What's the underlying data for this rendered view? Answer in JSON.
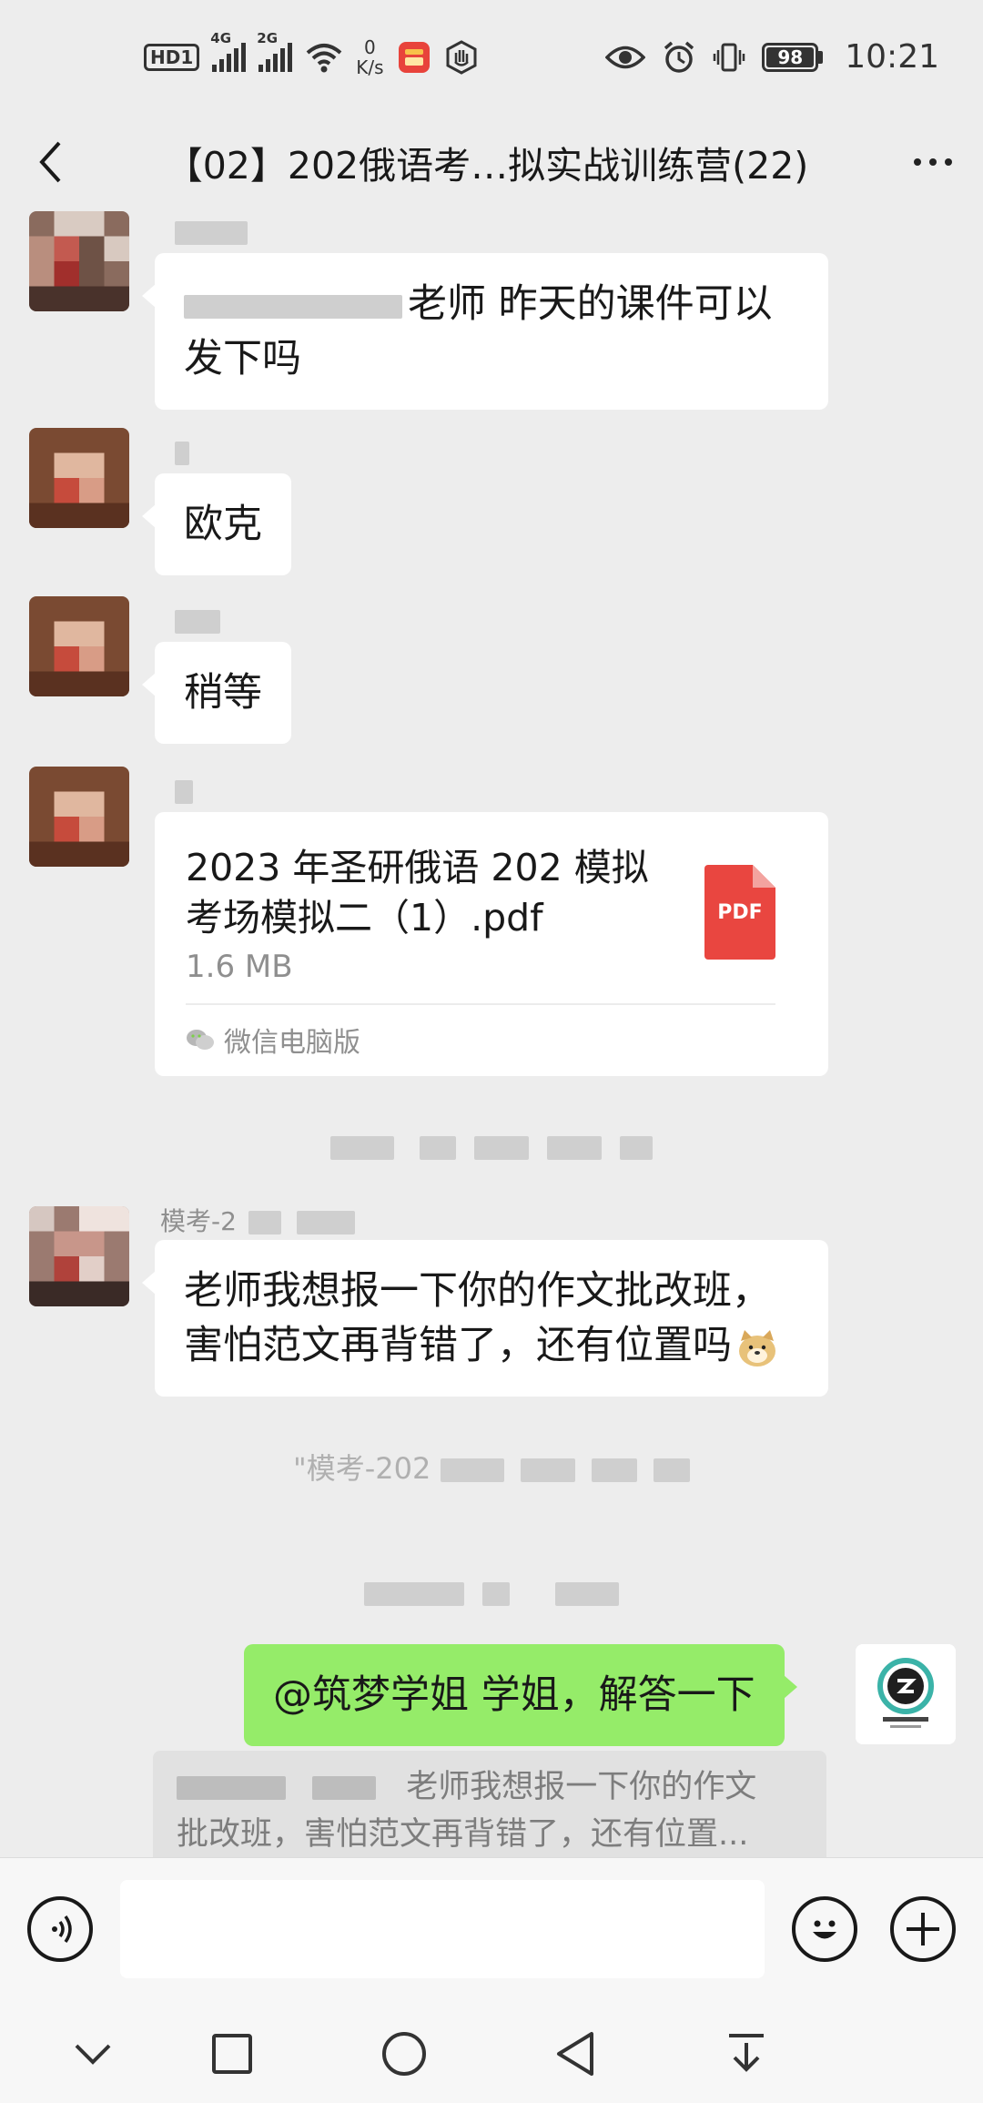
{
  "status_bar": {
    "hd_badge": "HD1",
    "signal_1_gen": "4G",
    "signal_2_gen": "2G",
    "net_speed_value": "0",
    "net_speed_unit": "K/s",
    "battery_level": "98",
    "time": "10:21",
    "icons": [
      "wifi-icon",
      "app-notification-icon",
      "hand-icon",
      "eye-icon",
      "alarm-icon",
      "vibrate-icon"
    ]
  },
  "header": {
    "title": "【02】202俄语考…拟实战训练营(22)",
    "back_icon": "chevron-left-icon",
    "more_icon": "more-dots-icon"
  },
  "messages": [
    {
      "type": "text",
      "side": "left",
      "text": "老师 昨天的课件可以发下吗",
      "mention_prefix_redacted": true
    },
    {
      "type": "text",
      "side": "left",
      "text": "欧克"
    },
    {
      "type": "text",
      "side": "left",
      "text": "稍等"
    },
    {
      "type": "file",
      "side": "left",
      "file_name": "2023 年圣研俄语 202 模拟考场模拟二（1）.pdf",
      "file_size": "1.6 MB",
      "file_type": "PDF",
      "source": "微信电脑版"
    },
    {
      "type": "text",
      "side": "left",
      "sender": "模考-2",
      "text": "老师我想报一下你的作文批改班，害怕范文再背错了，还有位置吗"
    },
    {
      "type": "system",
      "text": "\"模考-202"
    },
    {
      "type": "text",
      "side": "right",
      "text": "@筑梦学姐  学姐，解答一下"
    }
  ],
  "quote": {
    "text_line1": "老师我想报一下你的作文",
    "text_line2": "批改班，害怕范文再背错了，还有位置..."
  },
  "input": {
    "placeholder": "",
    "voice_icon": "voice-icon",
    "emoji_icon": "emoji-icon",
    "plus_icon": "plus-icon"
  },
  "nav": [
    "chevron-down-icon",
    "square-icon",
    "circle-icon",
    "triangle-back-icon",
    "download-icon"
  ]
}
